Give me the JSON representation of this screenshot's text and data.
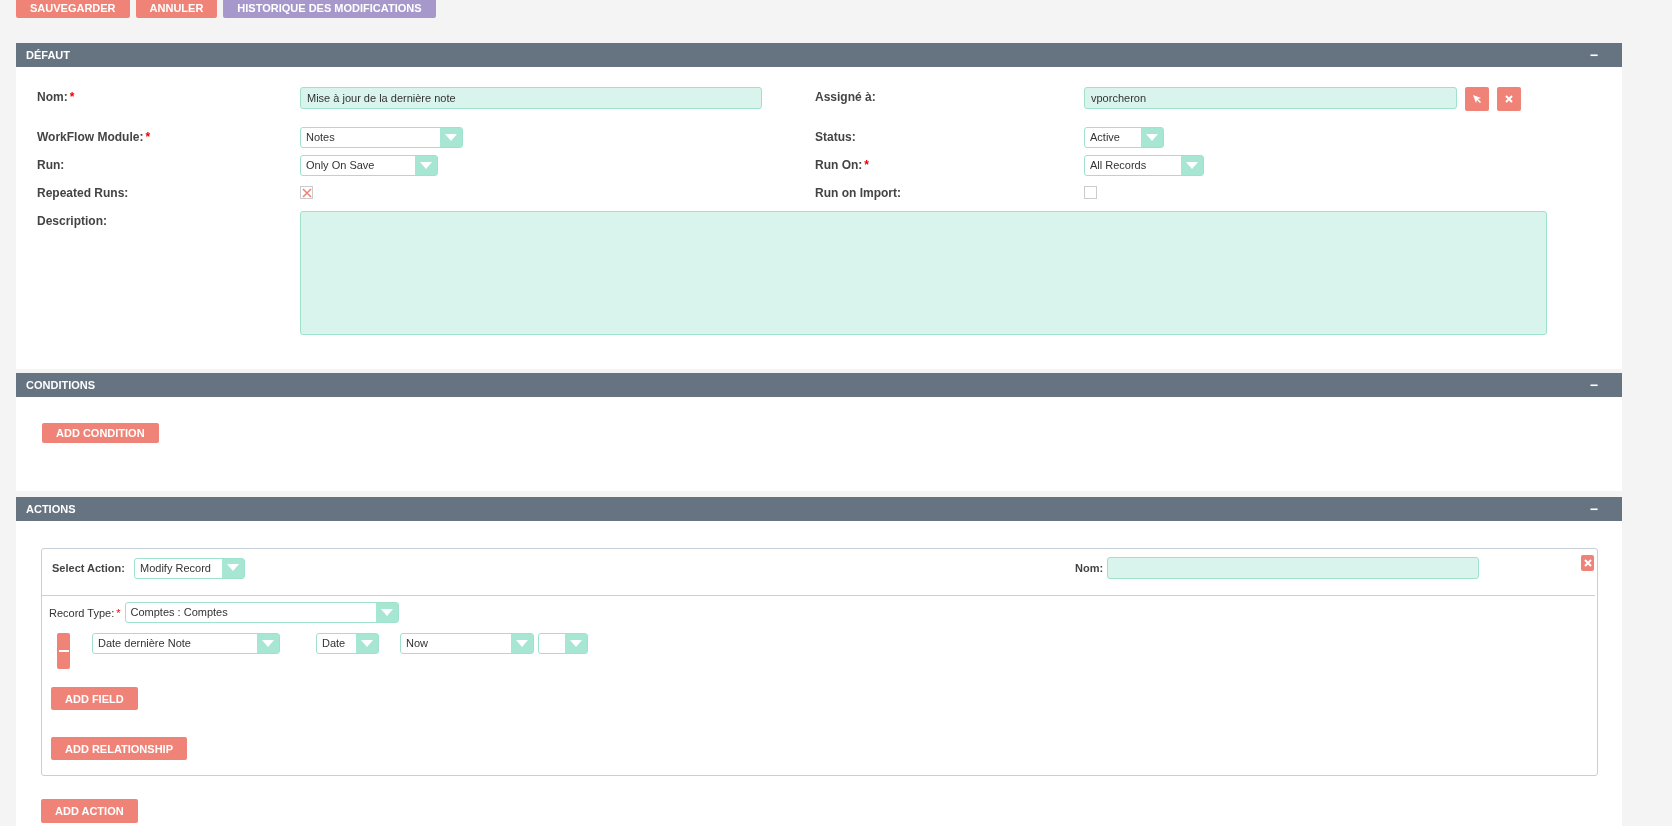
{
  "toolbar": [
    {
      "label": "SAUVEGARDER",
      "kind": "primary"
    },
    {
      "label": "ANNULER",
      "kind": "primary"
    },
    {
      "label": "HISTORIQUE DES MODIFICATIONS",
      "kind": "secondary"
    }
  ],
  "required_mark": "*",
  "collapse_symbol": "−",
  "default_panel": {
    "title": "DÉFAUT",
    "rows": [
      {
        "left": {
          "label": "Nom:",
          "required": true,
          "kind": "text",
          "value": "Mise à jour de la dernière note"
        },
        "right": {
          "label": "Assigné à:",
          "required": false,
          "kind": "relate",
          "value": "vporcheron"
        }
      },
      {
        "left": {
          "label": "WorkFlow Module:",
          "required": true,
          "kind": "select",
          "value": "Notes"
        },
        "right": {
          "label": "Status:",
          "required": false,
          "kind": "select",
          "value": "Active"
        }
      },
      {
        "left": {
          "label": "Run:",
          "required": false,
          "kind": "select",
          "value": "Only On Save"
        },
        "right": {
          "label": "Run On:",
          "required": true,
          "kind": "select",
          "value": "All Records"
        }
      },
      {
        "left": {
          "label": "Repeated Runs:",
          "required": false,
          "kind": "checkbox",
          "checked": true
        },
        "right": {
          "label": "Run on Import:",
          "required": false,
          "kind": "checkbox",
          "checked": false
        }
      }
    ],
    "description": {
      "label": "Description:"
    }
  },
  "conditions_panel": {
    "title": "CONDITIONS",
    "button": "ADD CONDITION"
  },
  "actions_panel": {
    "title": "ACTIONS",
    "action": {
      "select_label": "Select Action:",
      "select_value": "Modify Record",
      "name_label": "Nom:",
      "record_type_label": "Record Type:",
      "record_type_value": "Comptes : Comptes",
      "field_row": {
        "field": "Date dernière Note",
        "type": "Date",
        "value": "Now"
      },
      "add_field": "ADD FIELD",
      "add_relationship": "ADD RELATIONSHIP"
    },
    "add_action": "ADD ACTION"
  }
}
